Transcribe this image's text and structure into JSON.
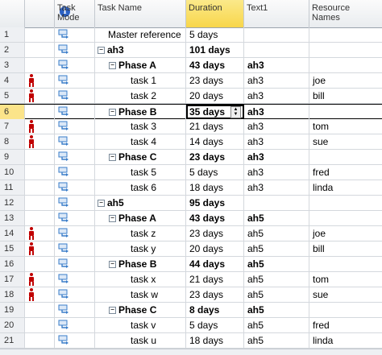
{
  "header": {
    "info_icon": "info-icon",
    "task_mode": "Task\nMode",
    "task_name": "Task Name",
    "duration": "Duration",
    "text1": "Text1",
    "resource_names": "Resource\nNames"
  },
  "colors": {
    "person_icon": "#c00000",
    "header_active": "#f8d64a",
    "mode_icon": "#3a7dc9"
  },
  "selected_row": 6,
  "rows": [
    {
      "num": "1",
      "indicator": false,
      "level": 0,
      "collapse": false,
      "bold": false,
      "name": "Master reference",
      "duration": "5 days",
      "text1": "",
      "resource": ""
    },
    {
      "num": "2",
      "indicator": false,
      "level": 0,
      "collapse": true,
      "bold": true,
      "name": "ah3",
      "duration": "101 days",
      "text1": "",
      "resource": ""
    },
    {
      "num": "3",
      "indicator": false,
      "level": 1,
      "collapse": true,
      "bold": true,
      "name": "Phase A",
      "duration": "43 days",
      "text1": "ah3",
      "resource": ""
    },
    {
      "num": "4",
      "indicator": true,
      "level": 2,
      "collapse": false,
      "bold": false,
      "name": "task 1",
      "duration": "23 days",
      "text1": "ah3",
      "resource": "joe"
    },
    {
      "num": "5",
      "indicator": true,
      "level": 2,
      "collapse": false,
      "bold": false,
      "name": "task 2",
      "duration": "20 days",
      "text1": "ah3",
      "resource": "bill"
    },
    {
      "num": "6",
      "indicator": false,
      "level": 1,
      "collapse": true,
      "bold": true,
      "name": "Phase B",
      "duration": "35 days",
      "text1": "ah3",
      "resource": ""
    },
    {
      "num": "7",
      "indicator": true,
      "level": 2,
      "collapse": false,
      "bold": false,
      "name": "task 3",
      "duration": "21 days",
      "text1": "ah3",
      "resource": "tom"
    },
    {
      "num": "8",
      "indicator": true,
      "level": 2,
      "collapse": false,
      "bold": false,
      "name": "task 4",
      "duration": "14 days",
      "text1": "ah3",
      "resource": "sue"
    },
    {
      "num": "9",
      "indicator": false,
      "level": 1,
      "collapse": true,
      "bold": true,
      "name": "Phase C",
      "duration": "23 days",
      "text1": "ah3",
      "resource": ""
    },
    {
      "num": "10",
      "indicator": false,
      "level": 2,
      "collapse": false,
      "bold": false,
      "name": "task 5",
      "duration": "5 days",
      "text1": "ah3",
      "resource": "fred"
    },
    {
      "num": "11",
      "indicator": false,
      "level": 2,
      "collapse": false,
      "bold": false,
      "name": "task 6",
      "duration": "18 days",
      "text1": "ah3",
      "resource": "linda"
    },
    {
      "num": "12",
      "indicator": false,
      "level": 0,
      "collapse": true,
      "bold": true,
      "name": "ah5",
      "duration": "95 days",
      "text1": "",
      "resource": ""
    },
    {
      "num": "13",
      "indicator": false,
      "level": 1,
      "collapse": true,
      "bold": true,
      "name": "Phase A",
      "duration": "43 days",
      "text1": "ah5",
      "resource": ""
    },
    {
      "num": "14",
      "indicator": true,
      "level": 2,
      "collapse": false,
      "bold": false,
      "name": "task z",
      "duration": "23 days",
      "text1": "ah5",
      "resource": "joe"
    },
    {
      "num": "15",
      "indicator": true,
      "level": 2,
      "collapse": false,
      "bold": false,
      "name": "task y",
      "duration": "20 days",
      "text1": "ah5",
      "resource": "bill"
    },
    {
      "num": "16",
      "indicator": false,
      "level": 1,
      "collapse": true,
      "bold": true,
      "name": "Phase B",
      "duration": "44 days",
      "text1": "ah5",
      "resource": ""
    },
    {
      "num": "17",
      "indicator": true,
      "level": 2,
      "collapse": false,
      "bold": false,
      "name": "task x",
      "duration": "21 days",
      "text1": "ah5",
      "resource": "tom"
    },
    {
      "num": "18",
      "indicator": true,
      "level": 2,
      "collapse": false,
      "bold": false,
      "name": "task w",
      "duration": "23 days",
      "text1": "ah5",
      "resource": "sue"
    },
    {
      "num": "19",
      "indicator": false,
      "level": 1,
      "collapse": true,
      "bold": true,
      "name": "Phase C",
      "duration": "8 days",
      "text1": "ah5",
      "resource": ""
    },
    {
      "num": "20",
      "indicator": false,
      "level": 2,
      "collapse": false,
      "bold": false,
      "name": "task v",
      "duration": "5 days",
      "text1": "ah5",
      "resource": "fred"
    },
    {
      "num": "21",
      "indicator": false,
      "level": 2,
      "collapse": false,
      "bold": false,
      "name": "task u",
      "duration": "18 days",
      "text1": "ah5",
      "resource": "linda"
    }
  ]
}
